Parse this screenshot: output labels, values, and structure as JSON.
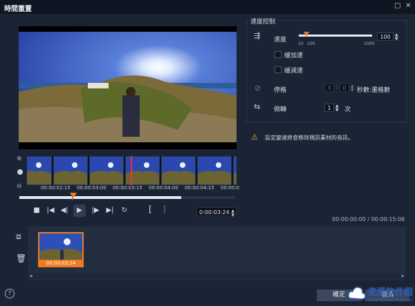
{
  "window": {
    "title": "時間重置",
    "restore_icon": "□",
    "close_icon": "✕"
  },
  "timeline": {
    "zoom_in": "⊕",
    "zoom_out": "⊖",
    "timecodes": [
      "00:00:02:15",
      "00:00:03:00",
      "00:00:03:15",
      "00:00:04:00",
      "00:00:04:15",
      "00:00:0"
    ],
    "current_position": 0.25,
    "in_out_fill": 0.75
  },
  "transport": {
    "stop": "■",
    "start": "|◀",
    "prev_frame": "◀|",
    "play": "▶",
    "next_frame": "|▶",
    "end": "▶|",
    "loop": "↻",
    "mark_in": "[",
    "mark_out": "]",
    "timecode": "0:00:03:24"
  },
  "speed_control": {
    "group_title": "速度控制",
    "speed_label": "速度",
    "speed_value": "100",
    "slider_fraction": 0.1,
    "ticks": [
      "10",
      "100",
      "1000"
    ],
    "ease_in_label": "緩加速",
    "ease_out_label": "緩減速",
    "freeze_label": "停格",
    "freeze_frames": "3",
    "freeze_seconds": "0",
    "freeze_unit": "秒數:畫格數",
    "reverse_label": "倒轉",
    "reverse_count": "1",
    "reverse_unit": "次"
  },
  "warning": {
    "text": "設定變速將會移除視訊素材的音訊。"
  },
  "duration": {
    "text": "00:00:00:00 / 00:00:15:06"
  },
  "clips": [
    {
      "label": "00:00:03:24"
    }
  ],
  "buttons": {
    "ok": "確定",
    "cancel": "取消",
    "help": "?"
  },
  "watermark": {
    "main": "麦葱软件园",
    "sub": "www.52maicong.com"
  },
  "colors": {
    "accent": "#f07b22",
    "background": "#1b2434",
    "marker": "#e33333"
  }
}
